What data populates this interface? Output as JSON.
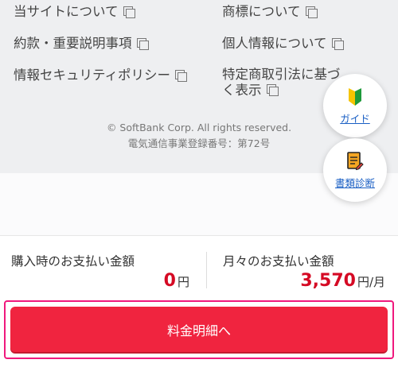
{
  "footer": {
    "links": {
      "about_site": "当サイトについて",
      "trademark": "商標について",
      "terms": "約款・重要説明事項",
      "privacy": "個人情報について",
      "security_policy": "情報セキュリティポリシー",
      "commercial_law": "特定商取引法に基づく表示"
    },
    "copyright": "© SoftBank Corp. All rights reserved.",
    "registration": "電気通信事業登録番号：第72号"
  },
  "fabs": {
    "guide_label": "ガイド",
    "document_check_label": "書類診断"
  },
  "summary": {
    "purchase_title": "購入時のお支払い金額",
    "purchase_amount": "0",
    "purchase_unit": "円",
    "monthly_title": "月々のお支払い金額",
    "monthly_amount": "3,570",
    "monthly_unit": "円/月"
  },
  "cta": {
    "label": "料金明細へ"
  },
  "colors": {
    "accent_red": "#d50a24",
    "cta_red": "#f0243f",
    "cta_outline": "#f0197d",
    "link_blue": "#1a5fc4",
    "footer_bg": "#eeeff1"
  }
}
